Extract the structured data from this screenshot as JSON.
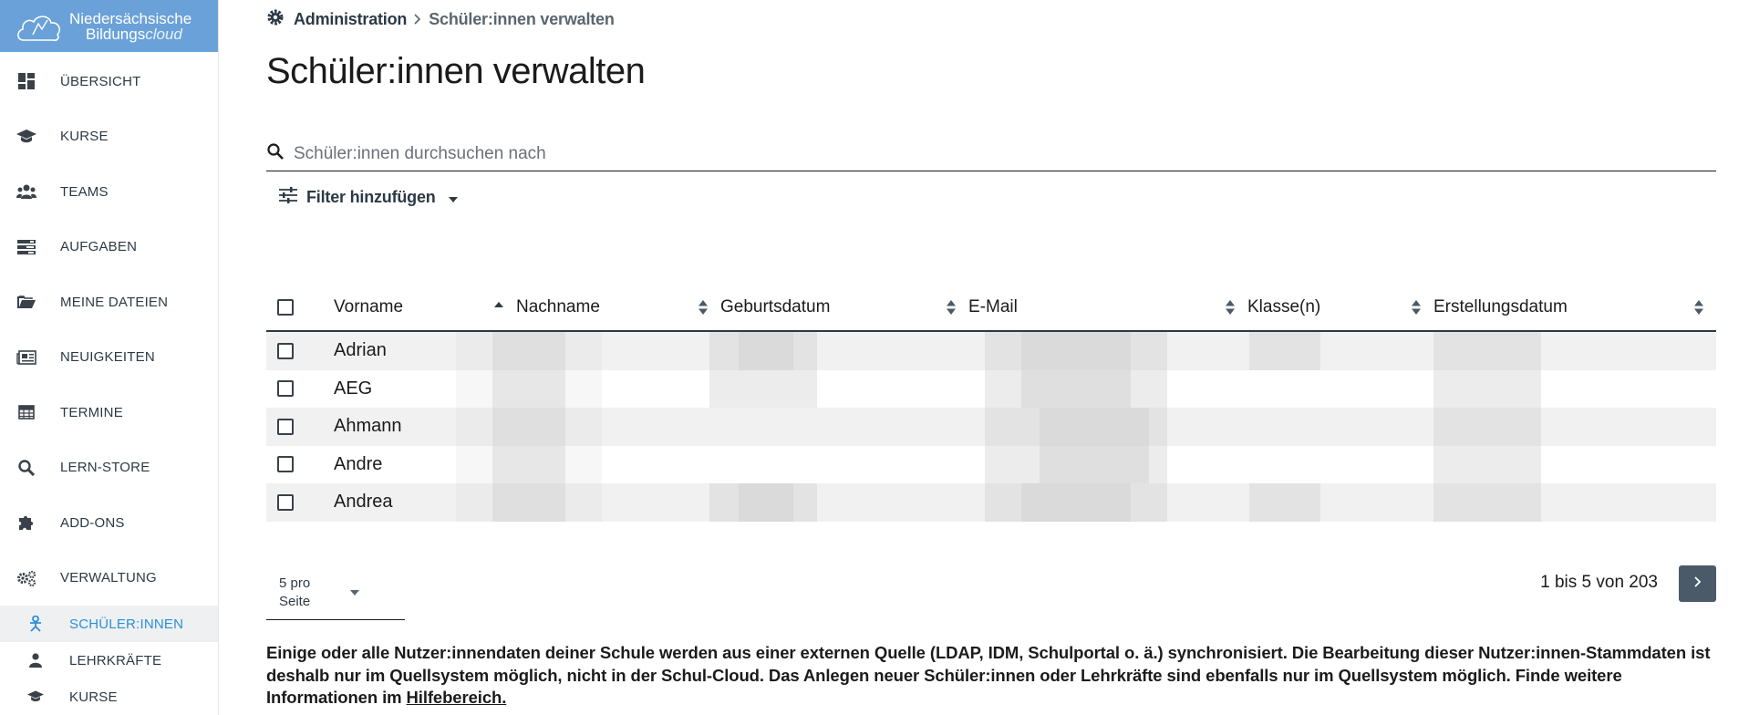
{
  "logo": {
    "line1": "Niedersächsische",
    "line2a": "Bildungs",
    "line2b": "cloud"
  },
  "nav": {
    "items": [
      {
        "label": "ÜBERSICHT",
        "icon": "dashboard-icon"
      },
      {
        "label": "KURSE",
        "icon": "graduation-cap-icon"
      },
      {
        "label": "TEAMS",
        "icon": "users-icon"
      },
      {
        "label": "AUFGABEN",
        "icon": "tasks-icon"
      },
      {
        "label": "MEINE DATEIEN",
        "icon": "folder-icon"
      },
      {
        "label": "NEUIGKEITEN",
        "icon": "newspaper-icon"
      },
      {
        "label": "TERMINE",
        "icon": "calendar-icon"
      },
      {
        "label": "LERN-STORE",
        "icon": "search-icon"
      },
      {
        "label": "ADD-ONS",
        "icon": "puzzle-icon"
      },
      {
        "label": "VERWALTUNG",
        "icon": "gears-icon"
      }
    ],
    "sub": [
      {
        "label": "SCHÜLER:INNEN",
        "icon": "student-icon",
        "active": true
      },
      {
        "label": "LEHRKRÄFTE",
        "icon": "teacher-icon"
      },
      {
        "label": "KURSE",
        "icon": "graduation-cap-icon"
      }
    ]
  },
  "breadcrumb": {
    "parent": "Administration",
    "current": "Schüler:innen verwalten"
  },
  "page_title": "Schüler:innen verwalten",
  "search": {
    "placeholder": "Schüler:innen durchsuchen nach",
    "value": ""
  },
  "filter": {
    "label": "Filter hinzufügen"
  },
  "table": {
    "columns": [
      "Vorname",
      "Nachname",
      "Geburtsdatum",
      "E-Mail",
      "Klasse(n)",
      "Erstellungsdatum"
    ],
    "sorted_by": "Vorname",
    "rows": [
      {
        "vorname": "Adrian"
      },
      {
        "vorname": "AEG"
      },
      {
        "vorname": "Ahmann"
      },
      {
        "vorname": "Andre"
      },
      {
        "vorname": "Andrea"
      }
    ]
  },
  "pagination": {
    "per_page_line1": "5 pro",
    "per_page_line2": "Seite",
    "info": "1 bis 5 von 203"
  },
  "info_text": "Einige oder alle Nutzer:innendaten deiner Schule werden aus einer externen Quelle (LDAP, IDM, Schulportal o. ä.) synchronisiert. Die Bearbeitung dieser Nutzer:innen-Stammdaten ist deshalb nur im Quellsystem möglich, nicht in der Schul-Cloud. Das Anlegen neuer Schüler:innen oder Lehrkräfte sind ebenfalls nur im Quellsystem möglich. Finde weitere Informationen im",
  "info_link": "Hilfebereich.",
  "colors": {
    "sidebar_header": "#6aa1d8",
    "active": "#2c8fd6",
    "button": "#4a5a68"
  }
}
